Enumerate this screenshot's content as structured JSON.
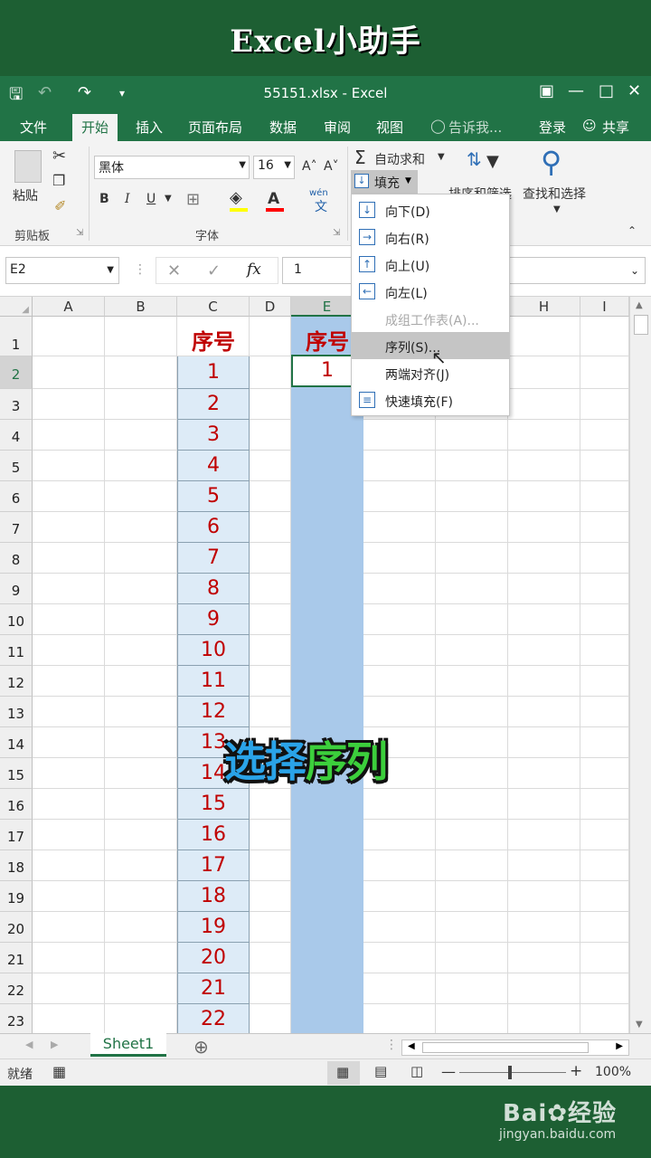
{
  "banner": {
    "title": "Excel小助手"
  },
  "window": {
    "title": "55151.xlsx - Excel"
  },
  "tabs": [
    {
      "label": "文件",
      "active": false
    },
    {
      "label": "开始",
      "active": true
    },
    {
      "label": "插入",
      "active": false
    },
    {
      "label": "页面布局",
      "active": false
    },
    {
      "label": "数据",
      "active": false
    },
    {
      "label": "审阅",
      "active": false
    },
    {
      "label": "视图",
      "active": false
    }
  ],
  "tell_me": "告诉我...",
  "login": "登录",
  "share": "共享",
  "ribbon": {
    "paste_label": "粘贴",
    "clipboard_group": "剪贴板",
    "font_name": "黑体",
    "font_size": "16",
    "font_group": "字体",
    "bold": "B",
    "italic": "I",
    "underline": "U",
    "grow_font": "A˄",
    "shrink_font": "A˅",
    "wen": "wén",
    "autosum": "自动求和",
    "fill": "填充",
    "sort_filter": "排序和筛选",
    "find_select": "查找和选择"
  },
  "formula_bar": {
    "name_box": "E2",
    "value": "1",
    "fx": "fx"
  },
  "columns": [
    "A",
    "B",
    "C",
    "D",
    "E",
    "F",
    "G",
    "H",
    "I"
  ],
  "rows": [
    "1",
    "2",
    "3",
    "4",
    "5",
    "6",
    "7",
    "8",
    "9",
    "10",
    "11",
    "12",
    "13",
    "14",
    "15",
    "16",
    "17",
    "18",
    "19",
    "20",
    "21",
    "22",
    "23"
  ],
  "cells": {
    "C1": "序号",
    "E1": "序号",
    "E2": "1",
    "C_values": [
      "1",
      "2",
      "3",
      "4",
      "5",
      "6",
      "7",
      "8",
      "9",
      "10",
      "11",
      "12",
      "13",
      "14",
      "15",
      "16",
      "17",
      "18",
      "19",
      "20",
      "21",
      "22"
    ]
  },
  "fill_menu": [
    {
      "label": "向下(D)",
      "icon": "arrow-down-icon",
      "state": "normal"
    },
    {
      "label": "向右(R)",
      "icon": "arrow-right-icon",
      "state": "normal"
    },
    {
      "label": "向上(U)",
      "icon": "arrow-up-icon",
      "state": "normal"
    },
    {
      "label": "向左(L)",
      "icon": "arrow-left-icon",
      "state": "normal"
    },
    {
      "label": "成组工作表(A)...",
      "icon": "",
      "state": "disabled"
    },
    {
      "label": "序列(S)...",
      "icon": "",
      "state": "hover"
    },
    {
      "label": "两端对齐(J)",
      "icon": "",
      "state": "normal"
    },
    {
      "label": "快速填充(F)",
      "icon": "flash-fill-icon",
      "state": "normal"
    }
  ],
  "overlay": {
    "part1": "选择",
    "part2": "序列",
    "color1": "#2aa3e8",
    "color2": "#3ccf3c"
  },
  "sheet": {
    "name": "Sheet1"
  },
  "status": {
    "ready": "就绪",
    "zoom": "100%"
  },
  "colors": {
    "excel_green": "#217346",
    "banner_green": "#1d5f33",
    "red_text": "#c00000"
  }
}
